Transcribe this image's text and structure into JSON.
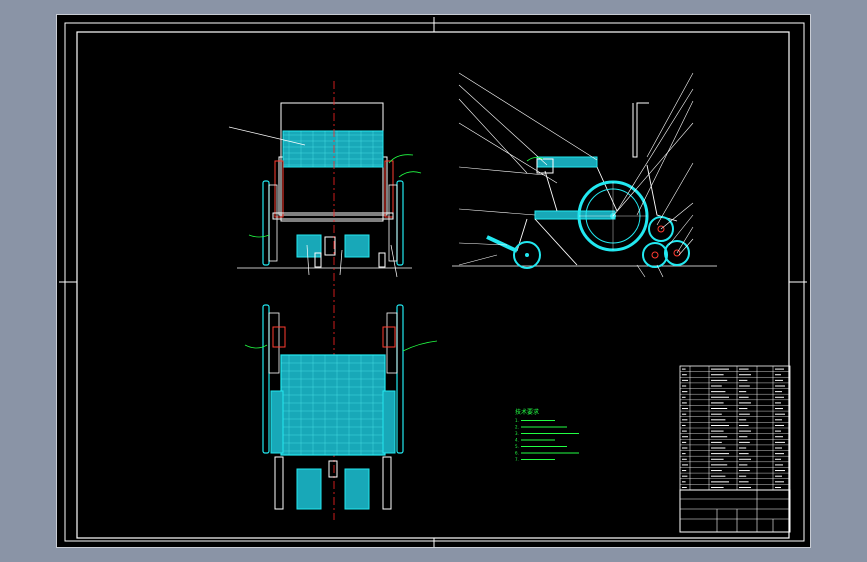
{
  "drawing": {
    "technical_requirements_heading": "技术要求",
    "technical_requirements": [
      "1.",
      "2.",
      "3.",
      "4.",
      "5.",
      "6.",
      "7."
    ]
  },
  "colors": {
    "background_outer": "#8a94a6",
    "sheet": "#000000",
    "frame_line": "#ffffff",
    "center_line": "#ff2222",
    "seat_fill": "#22c8d8",
    "wheel": "#22e8f0",
    "annotation_green": "#22ff44",
    "red_detail": "#ff3b30"
  },
  "icons": {
    "front_view": "wheelchair-front-view",
    "side_view": "wheelchair-side-view",
    "top_view": "wheelchair-top-view",
    "parts_list": "parts-list-table",
    "title_block": "title-block"
  }
}
